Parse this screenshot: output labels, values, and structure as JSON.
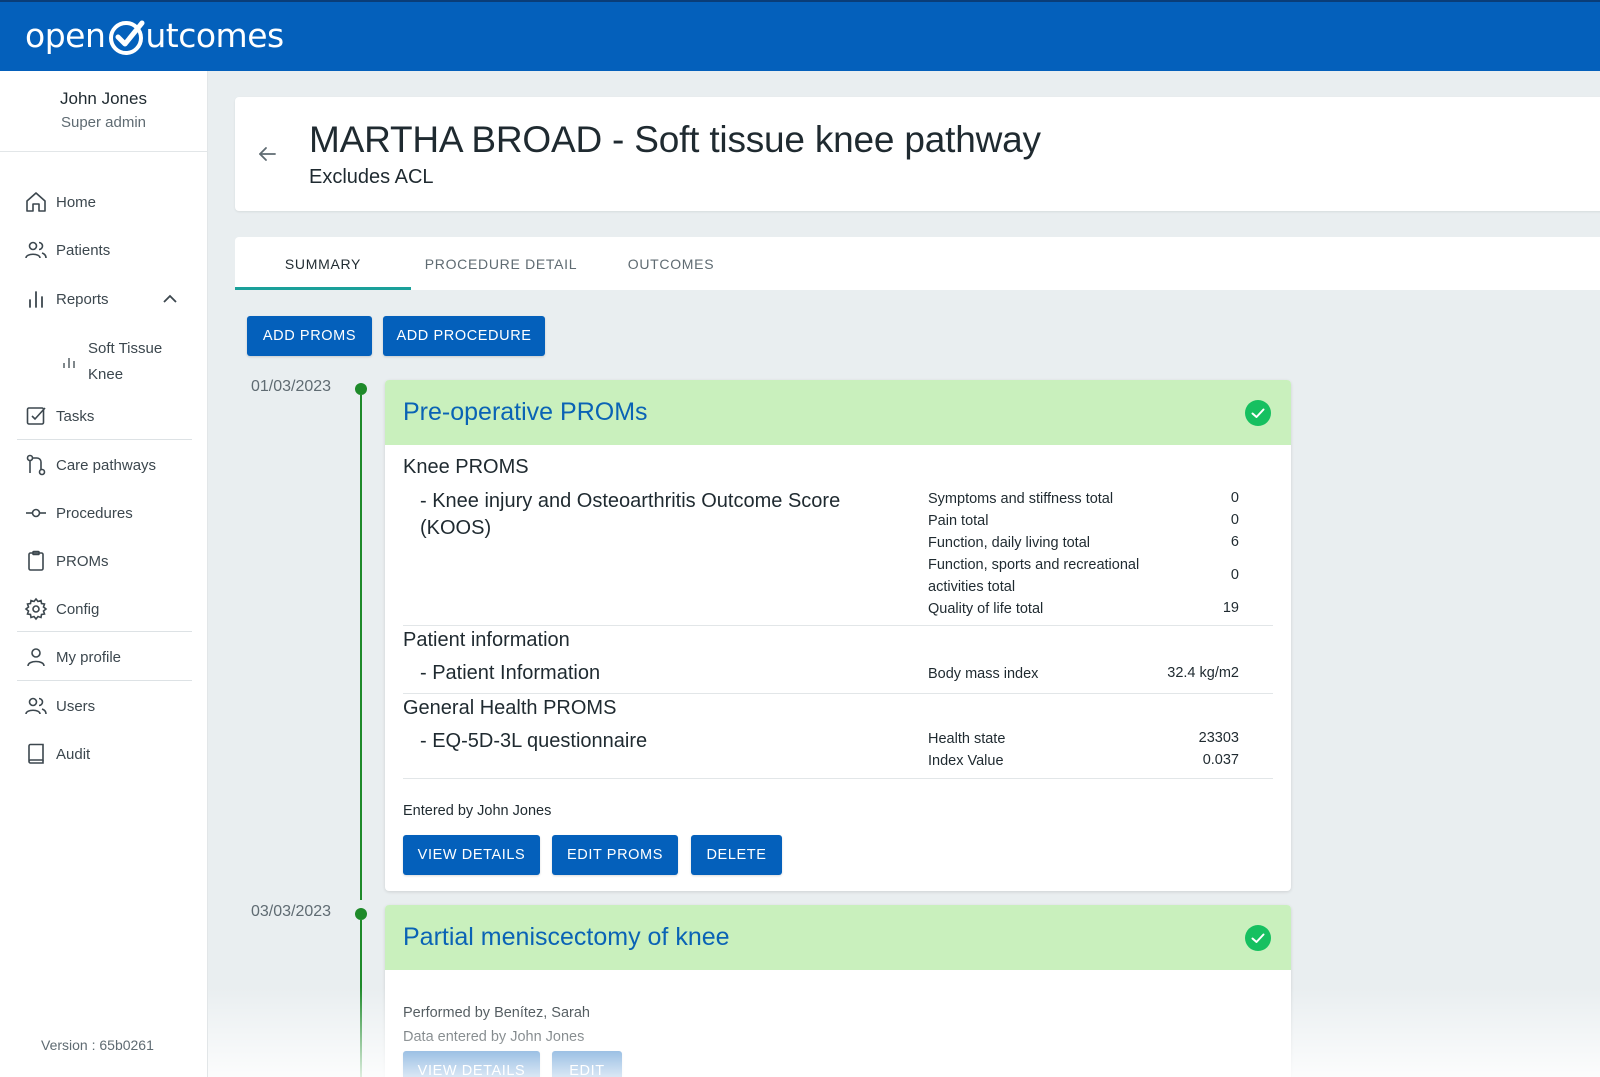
{
  "app": {
    "logo_text_left": "open",
    "logo_text_right": "utcomes"
  },
  "user": {
    "name": "John Jones",
    "role": "Super admin"
  },
  "sidebar": {
    "items": [
      {
        "label": "Home",
        "icon": "home-icon"
      },
      {
        "label": "Patients",
        "icon": "people-icon"
      },
      {
        "label": "Reports",
        "icon": "bar-chart-icon"
      },
      {
        "label": "Tasks",
        "icon": "checkbox-icon"
      },
      {
        "label": "Care pathways",
        "icon": "pathway-icon"
      },
      {
        "label": "Procedures",
        "icon": "commit-icon"
      },
      {
        "label": "PROMs",
        "icon": "clipboard-icon"
      },
      {
        "label": "Config",
        "icon": "gear-icon"
      },
      {
        "label": "My profile",
        "icon": "person-icon"
      },
      {
        "label": "Users",
        "icon": "people-icon"
      },
      {
        "label": "Audit",
        "icon": "book-icon"
      }
    ],
    "reports_sub": {
      "line1": "Soft Tissue",
      "line2": "Knee"
    },
    "version": "Version : 65b0261"
  },
  "header": {
    "title": "MARTHA BROAD - Soft tissue knee pathway",
    "subtitle": "Excludes ACL"
  },
  "tabs": [
    "SUMMARY",
    "PROCEDURE DETAIL",
    "OUTCOMES"
  ],
  "actions": {
    "add_proms": "ADD PROMS",
    "add_procedure": "ADD PROCEDURE"
  },
  "timeline": [
    {
      "date": "01/03/2023",
      "title": "Pre-operative PROMs",
      "sections": [
        {
          "title": "Knee PROMS",
          "item": "- Knee injury and Osteoarthritis Outcome Score (KOOS)",
          "metrics": [
            {
              "label": "Symptoms and stiffness total",
              "value": "0"
            },
            {
              "label": "Pain total",
              "value": "0"
            },
            {
              "label": "Function, daily living total",
              "value": "6"
            },
            {
              "label": "Function, sports and recreational activities total",
              "value": "0"
            },
            {
              "label": "Quality of life total",
              "value": "19"
            }
          ]
        },
        {
          "title": "Patient information",
          "item": "- Patient Information",
          "metrics": [
            {
              "label": "Body mass index",
              "value": "32.4 kg/m2"
            }
          ]
        },
        {
          "title": "General Health PROMS",
          "item": "- EQ-5D-3L questionnaire",
          "metrics": [
            {
              "label": "Health state",
              "value": "23303"
            },
            {
              "label": "Index Value",
              "value": "0.037"
            }
          ]
        }
      ],
      "entered_by": "Entered by John Jones",
      "buttons": [
        "VIEW DETAILS",
        "EDIT PROMS",
        "DELETE"
      ]
    },
    {
      "date": "03/03/2023",
      "title": "Partial meniscectomy of knee",
      "performed_by": "Performed by Benítez, Sarah",
      "data_entered_by": "Data entered by John Jones",
      "buttons": [
        "VIEW DETAILS",
        "EDIT"
      ]
    }
  ],
  "colors": {
    "brand": "#0460bb",
    "accent_tab": "#1aa09a",
    "timeline": "#1e8a2a",
    "card_header": "#c9f0bd",
    "check": "#16c060"
  }
}
